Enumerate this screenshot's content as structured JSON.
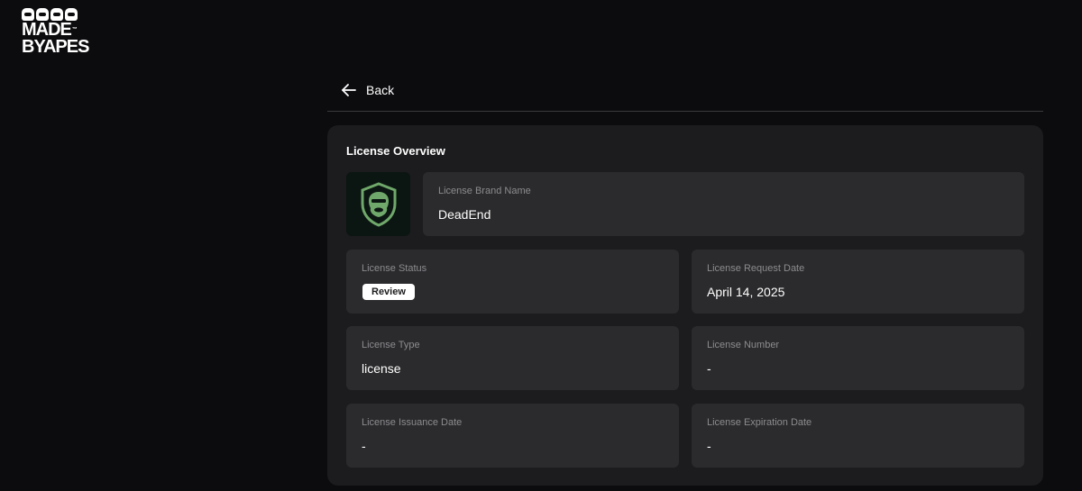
{
  "logo": {
    "line1": "MADE",
    "line2": "BYAPES",
    "tm": "™"
  },
  "nav": {
    "back_label": "Back"
  },
  "overview": {
    "title": "License Overview",
    "brand_name": {
      "label": "License Brand Name",
      "value": "DeadEnd"
    },
    "status": {
      "label": "License Status",
      "value": "Review"
    },
    "request_date": {
      "label": "License Request Date",
      "value": "April 14, 2025"
    },
    "type": {
      "label": "License Type",
      "value": "license"
    },
    "number": {
      "label": "License Number",
      "value": "-"
    },
    "issuance_date": {
      "label": "License Issuance Date",
      "value": "-"
    },
    "expiration_date": {
      "label": "License Expiration Date",
      "value": "-"
    }
  },
  "colors": {
    "background": "#0c0c0e",
    "card": "#1c1c1e",
    "field": "#2b2b2d",
    "label": "#8c8c90",
    "brand_green": "#6fa86a"
  },
  "icons": {
    "back": "arrow-left-icon",
    "brand": "ape-shield-icon"
  }
}
